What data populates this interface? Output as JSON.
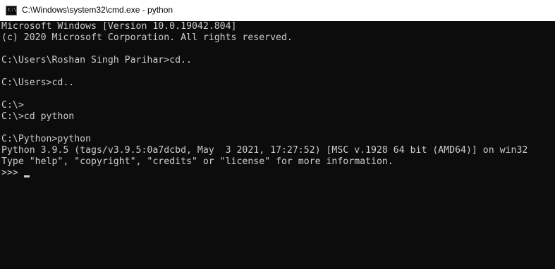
{
  "window": {
    "title": "C:\\Windows\\system32\\cmd.exe - python",
    "icon": "cmd-icon",
    "icon_glyph": "C:\\"
  },
  "console": {
    "lines": [
      "Microsoft Windows [Version 10.0.19042.804]",
      "(c) 2020 Microsoft Corporation. All rights reserved.",
      "",
      "C:\\Users\\Roshan Singh Parihar>cd..",
      "",
      "C:\\Users>cd..",
      "",
      "C:\\>",
      "C:\\>cd python",
      "",
      "C:\\Python>python",
      "Python 3.9.5 (tags/v3.9.5:0a7dcbd, May  3 2021, 17:27:52) [MSC v.1928 64 bit (AMD64)] on win32",
      "Type \"help\", \"copyright\", \"credits\" or \"license\" for more information."
    ],
    "prompt": ">>>"
  },
  "colors": {
    "background": "#0c0c0c",
    "text": "#cccccc",
    "titlebar": "#ffffff"
  }
}
